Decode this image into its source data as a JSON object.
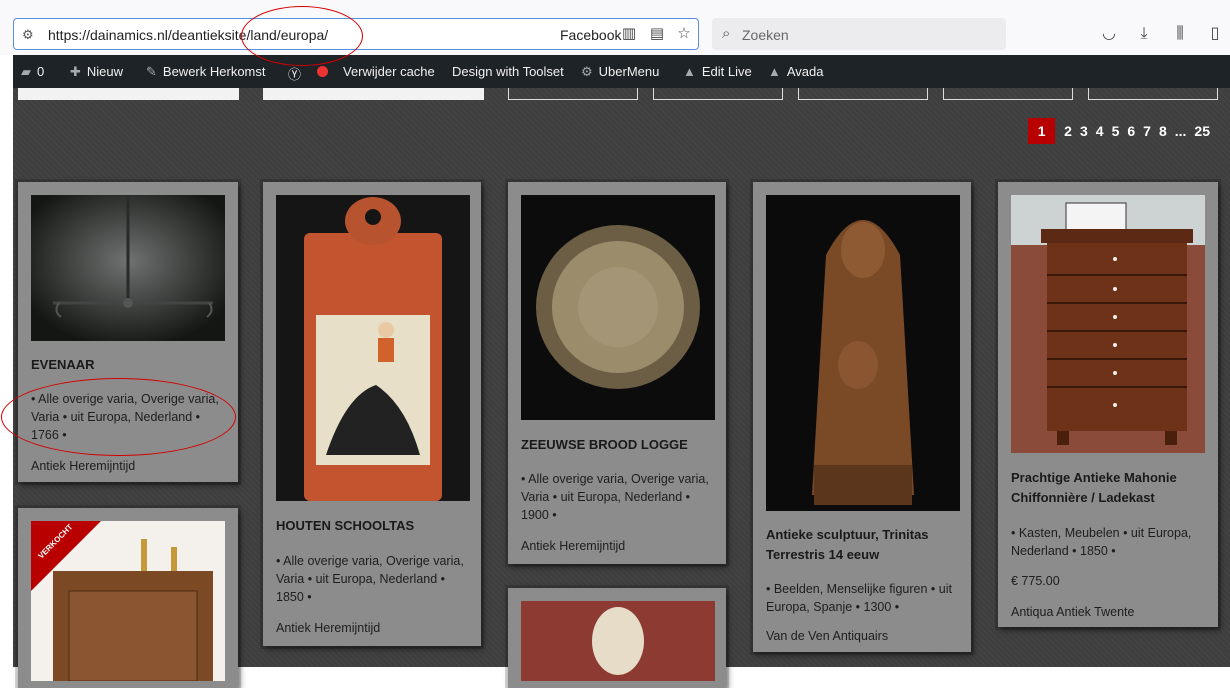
{
  "browser": {
    "url": "https://dainamics.nl/deantieksite/land/europa/",
    "facebook_label": "Facebook",
    "search_placeholder": "Zoeken"
  },
  "adminbar": {
    "comments_count": "0",
    "new_label": "Nieuw",
    "edit_label": "Bewerk Herkomst",
    "clear_cache_label": "Verwijder cache",
    "toolset_label": "Design with Toolset",
    "ubermenu_label": "UberMenu",
    "editlive_label": "Edit Live",
    "avada_label": "Avada"
  },
  "pagination": {
    "current": "1",
    "pages": [
      "2",
      "3",
      "4",
      "5",
      "6",
      "7",
      "8"
    ],
    "ellipsis": "...",
    "last": "25"
  },
  "cards": [
    {
      "title": "EVENAAR",
      "meta": "• Alle overige varia, Overige varia, Varia • uit Europa, Nederland • 1766 •",
      "shop": "Antiek Heremijntijd"
    },
    {
      "title": "HOUTEN SCHOOLTAS",
      "meta": "• Alle overige varia, Overige varia, Varia • uit Europa, Nederland • 1850 •",
      "shop": "Antiek Heremijntijd"
    },
    {
      "title": "ZEEUWSE BROOD LOGGE",
      "meta": "• Alle overige varia, Overige varia, Varia • uit Europa, Nederland • 1900 •",
      "shop": "Antiek Heremijntijd"
    },
    {
      "title": "Antieke sculptuur, Trinitas Terrestris 14 eeuw",
      "meta": "• Beelden, Menselijke figuren • uit Europa, Spanje • 1300 •",
      "shop": "Van de Ven Antiquairs"
    },
    {
      "title": "Prachtige Antieke Mahonie Chiffonnière / Ladekast",
      "meta": "• Kasten, Meubelen • uit Europa, Nederland • 1850 •",
      "price": "€ 775.00",
      "shop": "Antiqua Antiek Twente"
    }
  ],
  "badge": {
    "sold": "VERKOCHT"
  },
  "colors": {
    "accent": "#b80000",
    "card_bg": "#8c8c8c",
    "page_bg": "#3f3f3f",
    "annotation": "#d40000"
  }
}
